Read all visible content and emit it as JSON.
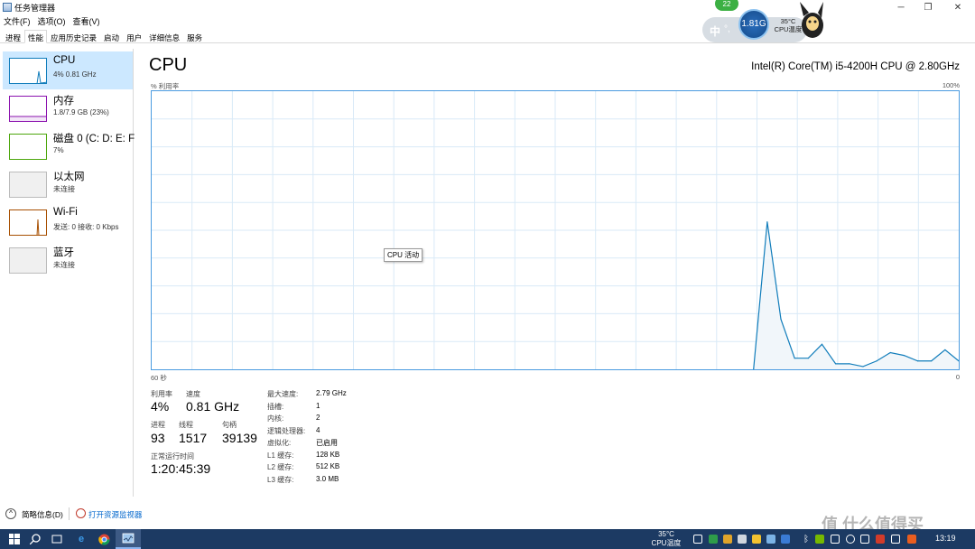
{
  "window": {
    "title": "任务管理器",
    "controls": {
      "minimize": "─",
      "maximize": "❐",
      "close": "✕"
    }
  },
  "menu": [
    "文件(F)",
    "选项(O)",
    "查看(V)"
  ],
  "tabs": [
    "进程",
    "性能",
    "应用历史记录",
    "启动",
    "用户",
    "详细信息",
    "服务"
  ],
  "active_tab": "性能",
  "sidebar": [
    {
      "name": "CPU",
      "sub": "4% 0.81 GHz",
      "color": "#117dbb",
      "selected": true,
      "icon": "cpu-thumbnail"
    },
    {
      "name": "内存",
      "sub": "1.8/7.9 GB (23%)",
      "color": "#8b12ae",
      "icon": "memory-thumbnail"
    },
    {
      "name": "磁盘 0 (C: D: E: F:",
      "sub": "7%",
      "color": "#4da60c",
      "icon": "disk-thumbnail"
    },
    {
      "name": "以太网",
      "sub": "未连接",
      "color": "#999999",
      "icon": "ethernet-thumbnail"
    },
    {
      "name": "Wi-Fi",
      "sub": "发送: 0 接收: 0 Kbps",
      "color": "#a74f01",
      "icon": "wifi-thumbnail"
    },
    {
      "name": "蓝牙",
      "sub": "未连接",
      "color": "#999999",
      "icon": "bluetooth-thumbnail"
    }
  ],
  "main": {
    "title": "CPU",
    "model": "Intel(R) Core(TM) i5-4200H CPU @ 2.80GHz",
    "y_axis_label": "% 利用率",
    "y_max_label": "100%",
    "x_left_label": "60 秒",
    "x_right_label": "0",
    "tooltip": "CPU 活动"
  },
  "chart_data": {
    "type": "area",
    "x_range_seconds": [
      60,
      0
    ],
    "ylim": [
      0,
      100
    ],
    "grid": true,
    "color": "#117dbb",
    "values": [
      null,
      null,
      null,
      null,
      null,
      null,
      null,
      null,
      null,
      null,
      null,
      null,
      null,
      null,
      null,
      null,
      null,
      null,
      null,
      null,
      null,
      null,
      null,
      null,
      null,
      null,
      null,
      null,
      null,
      null,
      null,
      null,
      null,
      null,
      null,
      null,
      null,
      null,
      null,
      null,
      null,
      null,
      null,
      null,
      0,
      53,
      18,
      4,
      4,
      9,
      2,
      2,
      1,
      3,
      6,
      5,
      3,
      3,
      7,
      3
    ]
  },
  "stats": {
    "utilization": {
      "label": "利用率",
      "value": "4%"
    },
    "speed": {
      "label": "速度",
      "value": "0.81 GHz"
    },
    "processes": {
      "label": "进程",
      "value": "93"
    },
    "threads": {
      "label": "线程",
      "value": "1517"
    },
    "handles": {
      "label": "句柄",
      "value": "39139"
    },
    "uptime": {
      "label": "正常运行时间",
      "value": "1:20:45:39"
    }
  },
  "specs": [
    {
      "label": "最大速度:",
      "value": "2.79 GHz"
    },
    {
      "label": "插槽:",
      "value": "1"
    },
    {
      "label": "内核:",
      "value": "2"
    },
    {
      "label": "逻辑处理器:",
      "value": "4"
    },
    {
      "label": "虚拟化:",
      "value": "已启用"
    },
    {
      "label": "L1 缓存:",
      "value": "128 KB"
    },
    {
      "label": "L2 缓存:",
      "value": "512 KB"
    },
    {
      "label": "L3 缓存:",
      "value": "3.0 MB"
    }
  ],
  "footer": {
    "fewer_details": "简略信息(D)",
    "open_monitor": "打开资源监视器"
  },
  "widget": {
    "badge": "22",
    "ime": "中",
    "ime_dot": "°,",
    "speed": "1.81G",
    "temp": "35°C",
    "temp_label": "CPU温度"
  },
  "taskbar": {
    "tray_temp": "35°C",
    "tray_temp_label": "CPU温度",
    "clock": "13:19"
  },
  "watermark": "值 什么值得买"
}
